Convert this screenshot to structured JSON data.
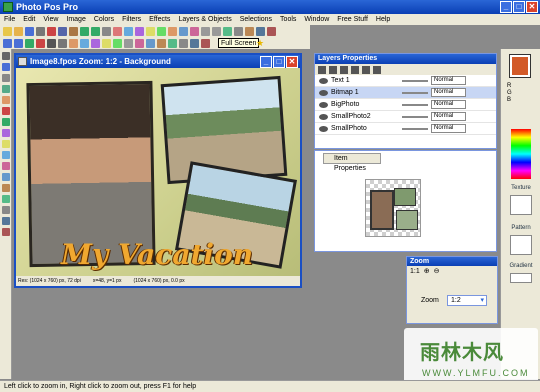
{
  "app": {
    "title": "Photo Pos Pro"
  },
  "menu": [
    "File",
    "Edit",
    "View",
    "Image",
    "Colors",
    "Filters",
    "Effects",
    "Layers & Objects",
    "Selections",
    "Tools",
    "Window",
    "Free Stuff",
    "Help"
  ],
  "toolbar": {
    "tooltip": "Full Screen"
  },
  "image_window": {
    "title": "Image8.fpos  Zoom: 1:2 - Background",
    "text_overlay": "My Vacation",
    "status": [
      "Res: (1024 x 760) px, 72 dpi",
      "x=48, y=1 px",
      "(1024 x 760) px, 0.0 px"
    ]
  },
  "layers": {
    "title": "Layers Properties",
    "rows": [
      {
        "name": "Text 1",
        "mode": "Normal",
        "selected": false
      },
      {
        "name": "Bitmap 1",
        "mode": "Normal",
        "selected": true
      },
      {
        "name": "BigPhoto",
        "mode": "Normal",
        "selected": false
      },
      {
        "name": "SmallPhoto2",
        "mode": "Normal",
        "selected": false
      },
      {
        "name": "SmallPhoto",
        "mode": "Normal",
        "selected": false
      }
    ]
  },
  "item_properties": {
    "tab_label": "Item Properties"
  },
  "zoom": {
    "title": "Zoom",
    "ratio": "1:1",
    "label": "Zoom",
    "value": "1:2"
  },
  "right_dock": {
    "rgb": [
      "R",
      "G",
      "B"
    ],
    "texture_label": "Texture",
    "pattern_label": "Pattern",
    "gradient_label": "Gradient"
  },
  "status_bar": "Left click to zoom in, Right click to zoom out, press F1 for help",
  "watermark": {
    "logo": "雨林木风",
    "url": "WWW.YLMFU.COM"
  },
  "colors": {
    "accent": "#0a3fb4",
    "foreground": "#d25a28",
    "title_text": "#f0a830"
  }
}
